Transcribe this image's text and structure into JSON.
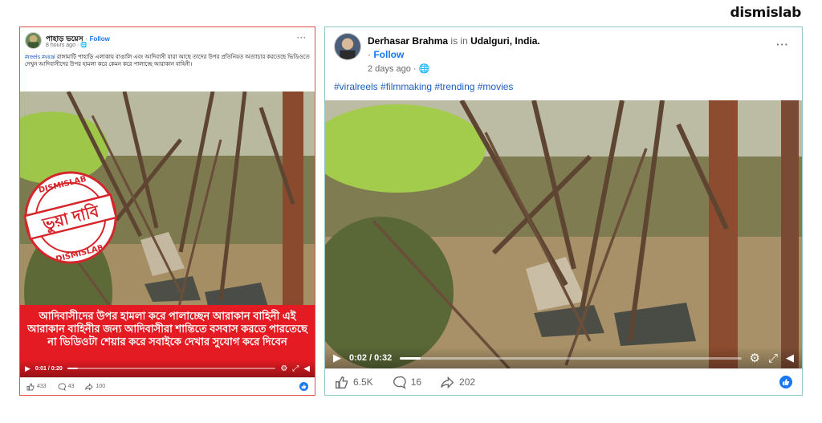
{
  "brand": {
    "text": "dismislab"
  },
  "left_post": {
    "author": "পাহাড় ভয়েস",
    "follow_label": "Follow",
    "time": "8 hours ago",
    "more": "···",
    "caption_tags": "#reels #viral",
    "caption_text": "রাঙ্গামাটি পাহাড়ি এলাকায় বাঙালি এবং আদিবাসী যারা আছে তাদের উপর প্রতিনিয়ত অত্যাচার করতেছে ভিডিওতে দেখুন আদিবাসীদের উপর হামলা করে কেমন করে পালাচ্ছে আরাকান বাহিনী।",
    "stamp": {
      "label": "ভুয়া দাবি",
      "ring_text": "DISMISLAB"
    },
    "overlay_text": "আদিবাসীদের উপর হামলা করে পালাচ্ছেন আরাকান বাহিনী এই আরাকান বাহিনীর জন্য আদিবাসীরা শান্তিতে বসবাস করতে পারতেছে না ভিডিওটা শেয়ার করে সবাইকে দেখার সুযোগ করে দিবেন",
    "video": {
      "time": "0:01 / 0:20",
      "progress": 0.05
    },
    "stats": {
      "reactions": "433",
      "comments": "43",
      "shares": "100"
    }
  },
  "right_post": {
    "author": "Derhasar Brahma",
    "is_in": "is in",
    "location": "Udalguri, India.",
    "follow_label": "Follow",
    "time": "2 days ago",
    "more": "···",
    "hashtags": "#viralreels #filmmaking #trending #movies",
    "video": {
      "time": "0:02 / 0:32",
      "progress": 0.06
    },
    "stats": {
      "reactions": "6.5K",
      "comments": "16",
      "shares": "202"
    }
  },
  "colors": {
    "fb_blue": "#1877f2",
    "false_claim_red": "#e41b23",
    "hashtag_blue": "#1b5fbf"
  }
}
